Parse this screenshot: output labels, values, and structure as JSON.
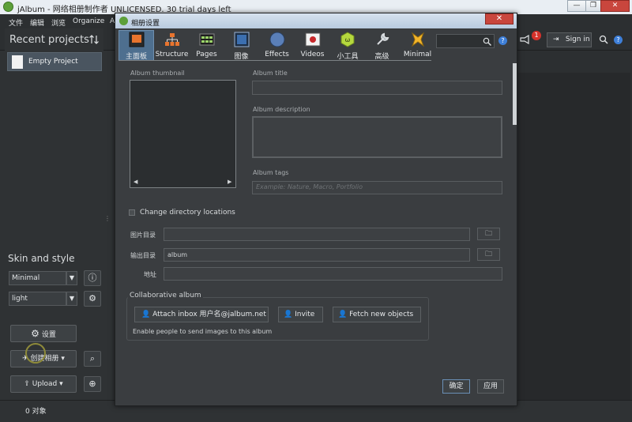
{
  "window": {
    "title": "jAlbum - 网络相册制作者 UNLICENSED. 30 trial days left",
    "minimize": "—",
    "restore": "❐",
    "close": "✕"
  },
  "menu": [
    "文件",
    "编辑",
    "浏览",
    "Organize",
    "A"
  ],
  "left_panel": {
    "recent_title": "Recent projects",
    "sort_icon": "sort-arrows",
    "project": "Empty Project",
    "skin_title": "Skin and style",
    "skin_value": "Minimal",
    "style_value": "light",
    "settings_button": "设置",
    "make_button": "创建相册",
    "upload_button": "Upload"
  },
  "status": {
    "left": "0 对象"
  },
  "toolbar_right": {
    "notification_count": "1",
    "signin": "Sign in"
  },
  "dialog": {
    "title": "相册设置",
    "close": "✕",
    "tabs": [
      {
        "label": "主面板",
        "icon": "main-panel-icon"
      },
      {
        "label": "Structure",
        "icon": "structure-icon"
      },
      {
        "label": "Pages",
        "icon": "pages-icon"
      },
      {
        "label": "图像",
        "icon": "image-icon"
      },
      {
        "label": "Effects",
        "icon": "effects-icon"
      },
      {
        "label": "Videos",
        "icon": "video-icon"
      },
      {
        "label": "小工具",
        "icon": "widgets-icon"
      },
      {
        "label": "高级",
        "icon": "advanced-icon"
      },
      {
        "label": "Minimal",
        "icon": "skin-icon"
      }
    ],
    "help": "?",
    "album_thumbnail_label": "Album thumbnail",
    "album_title_label": "Album title",
    "album_title_value": "",
    "album_description_label": "Album description",
    "album_description_value": "",
    "album_tags_label": "Album tags",
    "album_tags_placeholder": "Example: Nature, Macro, Portfolio",
    "change_dir_label": "Change directory locations",
    "image_dir_label": "图片目录",
    "image_dir_value": "",
    "output_dir_label": "输出目录",
    "output_dir_value": "album",
    "address_label": "地址",
    "address_value": "",
    "collab_title": "Collaborative album",
    "attach_inbox": "Attach inbox 用户名@jalbum.net",
    "invite": "Invite",
    "fetch_new": "Fetch new objects",
    "collab_hint": "Enable people to send images to this album",
    "ok": "确定",
    "apply": "应用"
  },
  "colors": {
    "dialog_bg": "#3a3d40",
    "tab_selected": "#4e6f8f",
    "accent_close": "#c9463d",
    "badge": "#d6322b"
  }
}
